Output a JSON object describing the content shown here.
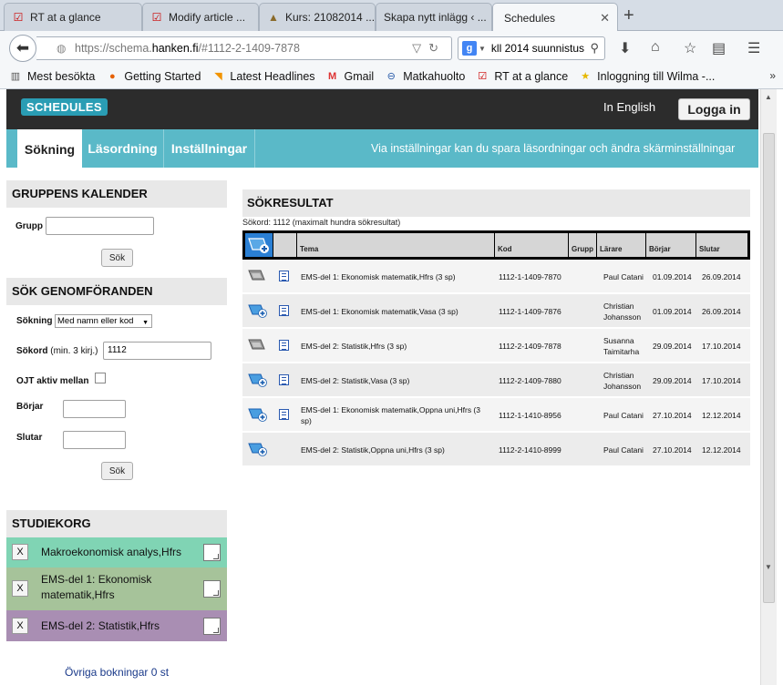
{
  "browser": {
    "tabs": [
      {
        "label": "RT at a glance",
        "icon": "checkmark-icon"
      },
      {
        "label": "Modify article ...",
        "icon": "checkmark-icon"
      },
      {
        "label": "Kurs: 21082014 ...",
        "icon": "hat-icon"
      },
      {
        "label": "Skapa nytt inlägg ‹ ...",
        "icon": "none"
      },
      {
        "label": "Schedules",
        "icon": "none",
        "active": true
      }
    ],
    "url_prefix": "https://schema.",
    "url_host": "hanken.fi",
    "url_path": "/#1112-2-1409-7878",
    "search_value": "kll 2014 suunnistus",
    "bookmarks": [
      {
        "label": "Mest besökta",
        "icon": "bookmark-icon"
      },
      {
        "label": "Getting Started",
        "icon": "firefox-icon"
      },
      {
        "label": "Latest Headlines",
        "icon": "rss-icon"
      },
      {
        "label": "Gmail",
        "icon": "gmail-icon"
      },
      {
        "label": "Matkahuolto",
        "icon": "bus-icon"
      },
      {
        "label": "RT at a glance",
        "icon": "checkmark-icon"
      },
      {
        "label": "Inloggning till Wilma -...",
        "icon": "star-icon"
      }
    ],
    "bookmarks_more": "»"
  },
  "header": {
    "logo": "SCHEDULES",
    "lang_link": "In English",
    "login_button": "Logga in"
  },
  "nav": {
    "tabs": [
      "Sökning",
      "Läsordning",
      "Inställningar"
    ],
    "info": "Via inställningar kan du spara läsordningar och ändra skärminställningar"
  },
  "group_calendar": {
    "title": "GRUPPENS KALENDER",
    "group_label": "Grupp",
    "group_value": "",
    "search_button": "Sök"
  },
  "search_implementations": {
    "title": "SÖK GENOMFÖRANDEN",
    "search_label": "Sökning",
    "search_mode": "Med namn eller kod",
    "keyword_label": "Sökord",
    "keyword_hint": "(min. 3 kirj.)",
    "keyword_value": "1112",
    "ojt_label": "OJT aktiv mellan",
    "start_label": "Börjar",
    "end_label": "Slutar",
    "search_button": "Sök"
  },
  "study_basket": {
    "title": "STUDIEKORG",
    "remove_label": "X",
    "items": [
      {
        "name": "Makroekonomisk analys,Hfrs",
        "color": "#80d4b4"
      },
      {
        "name": "EMS-del 1: Ekonomisk matematik,Hfrs",
        "color": "#a6c39a"
      },
      {
        "name": "EMS-del 2: Statistik,Hfrs",
        "color": "#a98eb3"
      }
    ],
    "other_bookings": "Övriga bokningar 0 st"
  },
  "results": {
    "title": "SÖKRESULTAT",
    "note": "Sökord: 1112 (maximalt hundra sökresultat)",
    "columns": [
      "Tema",
      "Kod",
      "Grupp",
      "Lärare",
      "Börjar",
      "Slutar"
    ],
    "rows": [
      {
        "icon": "calendar-disabled-icon",
        "list": true,
        "tema": "EMS-del 1: Ekonomisk matematik,Hfrs (3 sp)",
        "kod": "1112-1-1409-7870",
        "grupp": "",
        "larare": "Paul Catani",
        "borjar": "01.09.2014",
        "slutar": "26.09.2014"
      },
      {
        "icon": "calendar-add-icon",
        "list": true,
        "tema": "EMS-del 1: Ekonomisk matematik,Vasa (3 sp)",
        "kod": "1112-1-1409-7876",
        "grupp": "",
        "larare": "Christian Johansson",
        "borjar": "01.09.2014",
        "slutar": "26.09.2014"
      },
      {
        "icon": "calendar-disabled-icon",
        "list": true,
        "tema": "EMS-del 2: Statistik,Hfrs (3 sp)",
        "kod": "1112-2-1409-7878",
        "grupp": "",
        "larare": "Susanna Taimitarha",
        "borjar": "29.09.2014",
        "slutar": "17.10.2014"
      },
      {
        "icon": "calendar-add-icon",
        "list": true,
        "tema": "EMS-del 2: Statistik,Vasa (3 sp)",
        "kod": "1112-2-1409-7880",
        "grupp": "",
        "larare": "Christian Johansson",
        "borjar": "29.09.2014",
        "slutar": "17.10.2014"
      },
      {
        "icon": "calendar-add-icon",
        "list": true,
        "tema": "EMS-del 1: Ekonomisk matematik,Oppna uni,Hfrs (3 sp)",
        "kod": "1112-1-1410-8956",
        "grupp": "",
        "larare": "Paul Catani",
        "borjar": "27.10.2014",
        "slutar": "12.12.2014"
      },
      {
        "icon": "calendar-add-icon",
        "list": false,
        "tema": "EMS-del 2: Statistik,Oppna uni,Hfrs (3 sp)",
        "kod": "1112-2-1410-8999",
        "grupp": "",
        "larare": "Paul Catani",
        "borjar": "27.10.2014",
        "slutar": "12.12.2014"
      }
    ]
  },
  "colors": {
    "accent": "#5ab9c8",
    "logo": "#2a9db4",
    "header": "#2c2c2c"
  }
}
